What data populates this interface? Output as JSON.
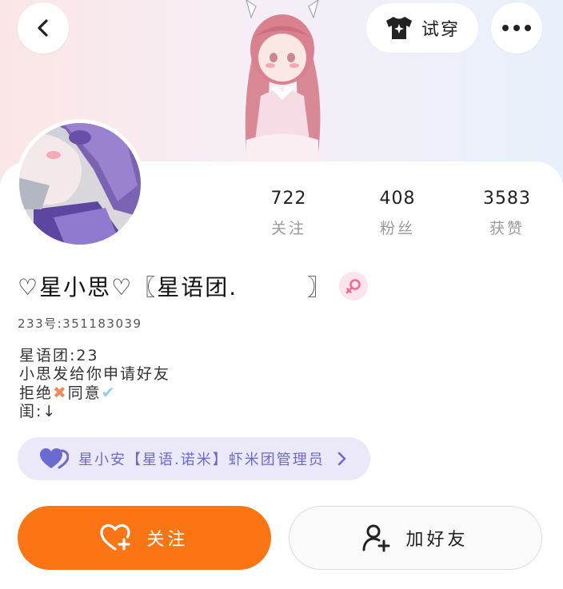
{
  "header": {
    "tryon_label": "试穿"
  },
  "stats": [
    {
      "value": "722",
      "label": "关注"
    },
    {
      "value": "408",
      "label": "粉丝"
    },
    {
      "value": "3583",
      "label": "获赞"
    }
  ],
  "profile": {
    "name": "♡星小思♡〖星语团.        〗",
    "uid": "233号:351183039"
  },
  "bio": {
    "line1": "星语团:23",
    "line2": "小思发给你申请好友",
    "line3_before": "拒绝",
    "line3_mid": "同意",
    "line4": "闺:↓"
  },
  "club": {
    "label": "星小安【星语.诺米】虾米团管理员"
  },
  "actions": {
    "follow_label": "关注",
    "add_friend_label": "加好友"
  },
  "colors": {
    "accent_orange": "#fb7514",
    "club_text": "#6b6ad0",
    "club_bg": "#ebe8fa",
    "gender_pink": "#f06a95"
  },
  "icons": {
    "back": "chevron-left-icon",
    "tryon": "tshirt-sparkle-icon",
    "more": "more-dots-icon",
    "gender": "female-symbol-icon",
    "club": "double-heart-icon",
    "club_arrow": "chevron-right-icon",
    "follow": "heart-plus-icon",
    "add_friend": "user-plus-icon"
  }
}
